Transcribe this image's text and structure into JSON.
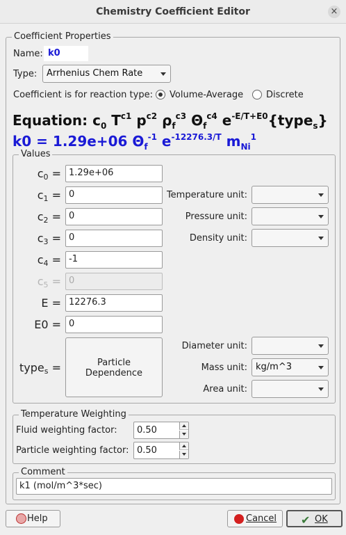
{
  "window": {
    "title": "Chemistry Coefficient Editor",
    "close_icon": "close-icon"
  },
  "coefficient_properties": {
    "legend": "Coefficient Properties",
    "name_label": "Name:",
    "name_value": "k0",
    "type_label": "Type:",
    "type_value": "Arrhenius Chem Rate",
    "reaction_type_label": "Coefficient is for reaction type:",
    "reaction_options": [
      {
        "label": "Volume-Average",
        "selected": true
      },
      {
        "label": "Discrete",
        "selected": false
      }
    ],
    "equation": {
      "prefix": "Equation: ",
      "c": "c",
      "c0_sub": "0",
      "T": " T",
      "T_sup": "c1",
      "p": " p",
      "p_sup": "c2",
      "rho": " ρ",
      "rho_sub": "f",
      "rho_sup": "c3",
      "theta": " Θ",
      "theta_sub": "f",
      "theta_sup": "c4",
      "e": " e",
      "e_sup": "-E/T+E0",
      "types_open": "{type",
      "types_sub": "s",
      "types_close": "}"
    },
    "result": {
      "main": "k0 = 1.29e+06 Θ",
      "theta_sub": "f",
      "theta_sup": "-1",
      "e": " e",
      "e_sup": "-12276.3/T",
      "m": " m",
      "m_sub": "Ni",
      "m_sup": "1",
      "color": "#1a1ad6"
    }
  },
  "values": {
    "legend": "Values",
    "rows": [
      {
        "label": "c",
        "sub": "0",
        "value": "1.29e+06",
        "disabled": false
      },
      {
        "label": "c",
        "sub": "1",
        "value": "0",
        "disabled": false
      },
      {
        "label": "c",
        "sub": "2",
        "value": "0",
        "disabled": false
      },
      {
        "label": "c",
        "sub": "3",
        "value": "0",
        "disabled": false
      },
      {
        "label": "c",
        "sub": "4",
        "value": "-1",
        "disabled": false
      },
      {
        "label": "c",
        "sub": "5",
        "value": "0",
        "disabled": true
      },
      {
        "label": "E",
        "sub": "",
        "value": "12276.3",
        "disabled": false
      },
      {
        "label": "E0",
        "sub": "",
        "value": "0",
        "disabled": false
      }
    ],
    "eq_sign": "=",
    "types_label": "type",
    "types_sub": "s",
    "particle_button": "Particle\nDependence",
    "units": [
      {
        "label": "Temperature unit:",
        "value": ""
      },
      {
        "label": "Pressure unit:",
        "value": ""
      },
      {
        "label": "Density unit:",
        "value": ""
      },
      {
        "label": "Diameter unit:",
        "value": ""
      },
      {
        "label": "Mass unit:",
        "value": "kg/m^3"
      },
      {
        "label": "Area unit:",
        "value": ""
      }
    ]
  },
  "temperature_weighting": {
    "legend": "Temperature Weighting",
    "fluid_label": "Fluid weighting factor:",
    "fluid_value": "0.50",
    "particle_label": "Particle weighting factor:",
    "particle_value": "0.50"
  },
  "comment": {
    "legend": "Comment",
    "value": "k1 (mol/m^3*sec)"
  },
  "footer": {
    "help_label": "Help",
    "cancel_label": "Cancel",
    "ok_label": "OK",
    "cancel_accel": "C",
    "ok_accel": "O"
  }
}
